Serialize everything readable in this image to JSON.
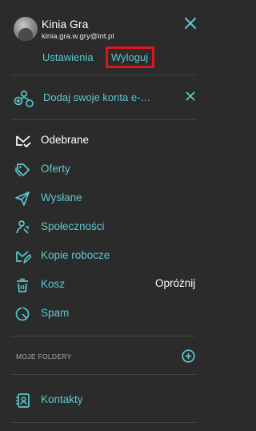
{
  "account": {
    "name": "Kinia Gra",
    "email": "kinia.gra.w.gry@int.pl",
    "settings_label": "Ustawienia",
    "logout_label": "Wyloguj"
  },
  "add_account": {
    "label": "Dodaj swoje konta e-…"
  },
  "nav": {
    "items": [
      {
        "label": "Odebrane"
      },
      {
        "label": "Oferty"
      },
      {
        "label": "Wysłane"
      },
      {
        "label": "Społeczności"
      },
      {
        "label": "Kopie robocze"
      },
      {
        "label": "Kosz"
      },
      {
        "label": "Spam"
      }
    ],
    "empty_trash_label": "Opróżnij"
  },
  "folders": {
    "section_title": "MOJE FOLDERY"
  },
  "contacts": {
    "label": "Kontakty"
  },
  "colors": {
    "background": "#2b2b2b",
    "accent": "#5cc8d0",
    "highlight_border": "#e0141c",
    "text": "#ffffff",
    "muted": "#a8a8a8"
  },
  "icons": {
    "close": "close-icon",
    "add_account": "add-account-icon",
    "inbox": "inbox-icon",
    "offers": "tag-icon",
    "sent": "send-icon",
    "social": "people-icon",
    "drafts": "draft-icon",
    "trash": "trash-icon",
    "spam": "spam-icon",
    "add_folder": "plus-circle-icon",
    "contacts": "contacts-icon"
  }
}
